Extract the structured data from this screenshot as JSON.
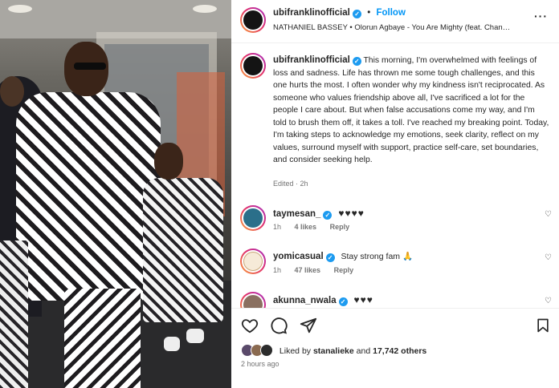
{
  "header": {
    "username": "ubifranklinofficial",
    "follow_label": "Follow",
    "audio": "NATHANIEL BASSEY • Olorun Agbaye - You Are Mighty (feat. Chandle...",
    "more_icon": "more-horizontal-icon"
  },
  "caption": {
    "username": "ubifranklinofficial",
    "text": "This morning, I'm overwhelmed with feelings of loss and sadness. Life has thrown me some tough challenges, and this one hurts the most. I often wonder why my kindness isn't reciprocated. As someone who values friendship above all, I've sacrificed a lot for the people I care about. But when false accusations come my way, and I'm told to brush them off, it takes a toll. I've reached my breaking point. Today, I'm taking steps to acknowledge my emotions, seek clarity, reflect on my values, surround myself with support, practice self-care, set boundaries, and consider seeking help.",
    "meta": "Edited · 2h"
  },
  "comments": [
    {
      "username": "taymesan_",
      "text": "♥♥♥♥",
      "time": "1h",
      "likes": "4 likes",
      "reply": "Reply",
      "avatar_color": "#2b6f8a"
    },
    {
      "username": "yomicasual",
      "text": "Stay strong fam 🙏",
      "time": "1h",
      "likes": "47 likes",
      "reply": "Reply",
      "avatar_color": "#7a5c3a"
    },
    {
      "username": "akunna_nwala",
      "text": "♥♥♥",
      "time": "",
      "likes": "",
      "reply": "",
      "avatar_color": "#8a7060"
    }
  ],
  "actions": {
    "like_icon": "heart-icon",
    "comment_icon": "comment-icon",
    "share_icon": "share-icon",
    "save_icon": "bookmark-icon"
  },
  "likes": {
    "prefix": "Liked by",
    "user": "stanalieke",
    "middle": "and",
    "others": "17,742 others"
  },
  "timestamp": "2 hours ago",
  "colors": {
    "accent": "#0095f6",
    "verified": "#1d9bf0",
    "heart": "#e0245e",
    "muted": "#737373"
  }
}
